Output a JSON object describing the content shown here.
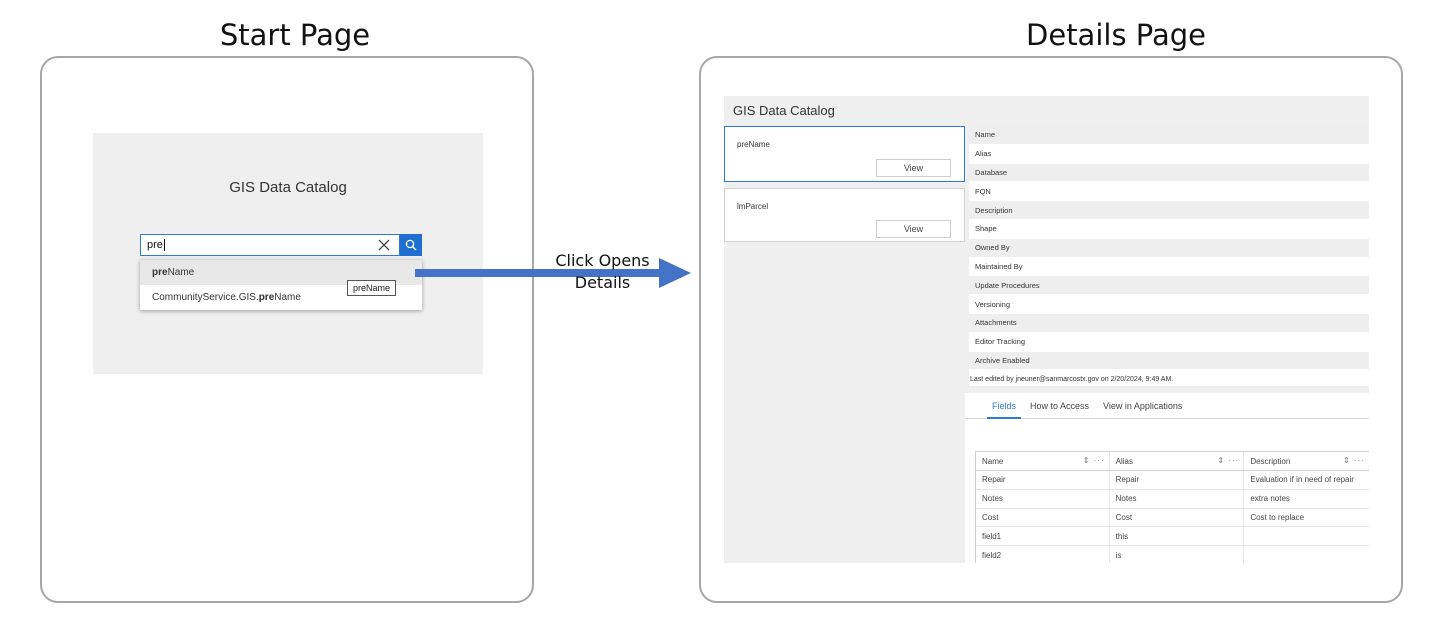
{
  "start_page": {
    "heading": "Start Page",
    "app_title": "GIS Data Catalog",
    "search": {
      "value": "pre"
    },
    "suggestions": [
      {
        "bold": "pre",
        "rest": "Name",
        "prefix": ""
      },
      {
        "prefix": "CommunityService.GIS.",
        "bold": "pre",
        "rest": "Name"
      }
    ],
    "tooltip": "preName"
  },
  "arrow": {
    "label_line1": "Click Opens",
    "label_line2": "Details",
    "color": "#4472c4"
  },
  "details_page": {
    "heading": "Details Page",
    "app_title": "GIS Data Catalog",
    "cards": [
      {
        "name": "preName",
        "button": "View"
      },
      {
        "name": "lmParcel",
        "button": "View"
      }
    ],
    "metadata_labels": [
      "Name",
      "Alias",
      "Database",
      "FQN",
      "Description",
      "Shape",
      "Owned By",
      "Maintained By",
      "Update Procedures",
      "Versioning",
      "Attachments",
      "Editor Tracking",
      "Archive Enabled"
    ],
    "last_edited": "Last edited by jneuner@sanmarcostx.gov on 2/20/2024, 9:49 AM.",
    "tabs": [
      "Fields",
      "How to Access",
      "View in Applications"
    ],
    "fields_table": {
      "headers": [
        "Name",
        "Alias",
        "Description"
      ],
      "rows": [
        [
          "Repair",
          "Repair",
          "Evaluation if in need of repair"
        ],
        [
          "Notes",
          "Notes",
          "extra notes"
        ],
        [
          "Cost",
          "Cost",
          "Cost to replace"
        ],
        [
          "field1",
          "this",
          ""
        ],
        [
          "field2",
          "is",
          ""
        ]
      ]
    }
  },
  "colors": {
    "accent": "#2f7ad6",
    "panel_bg": "#efefef",
    "frame_border": "#a6a6a6"
  }
}
